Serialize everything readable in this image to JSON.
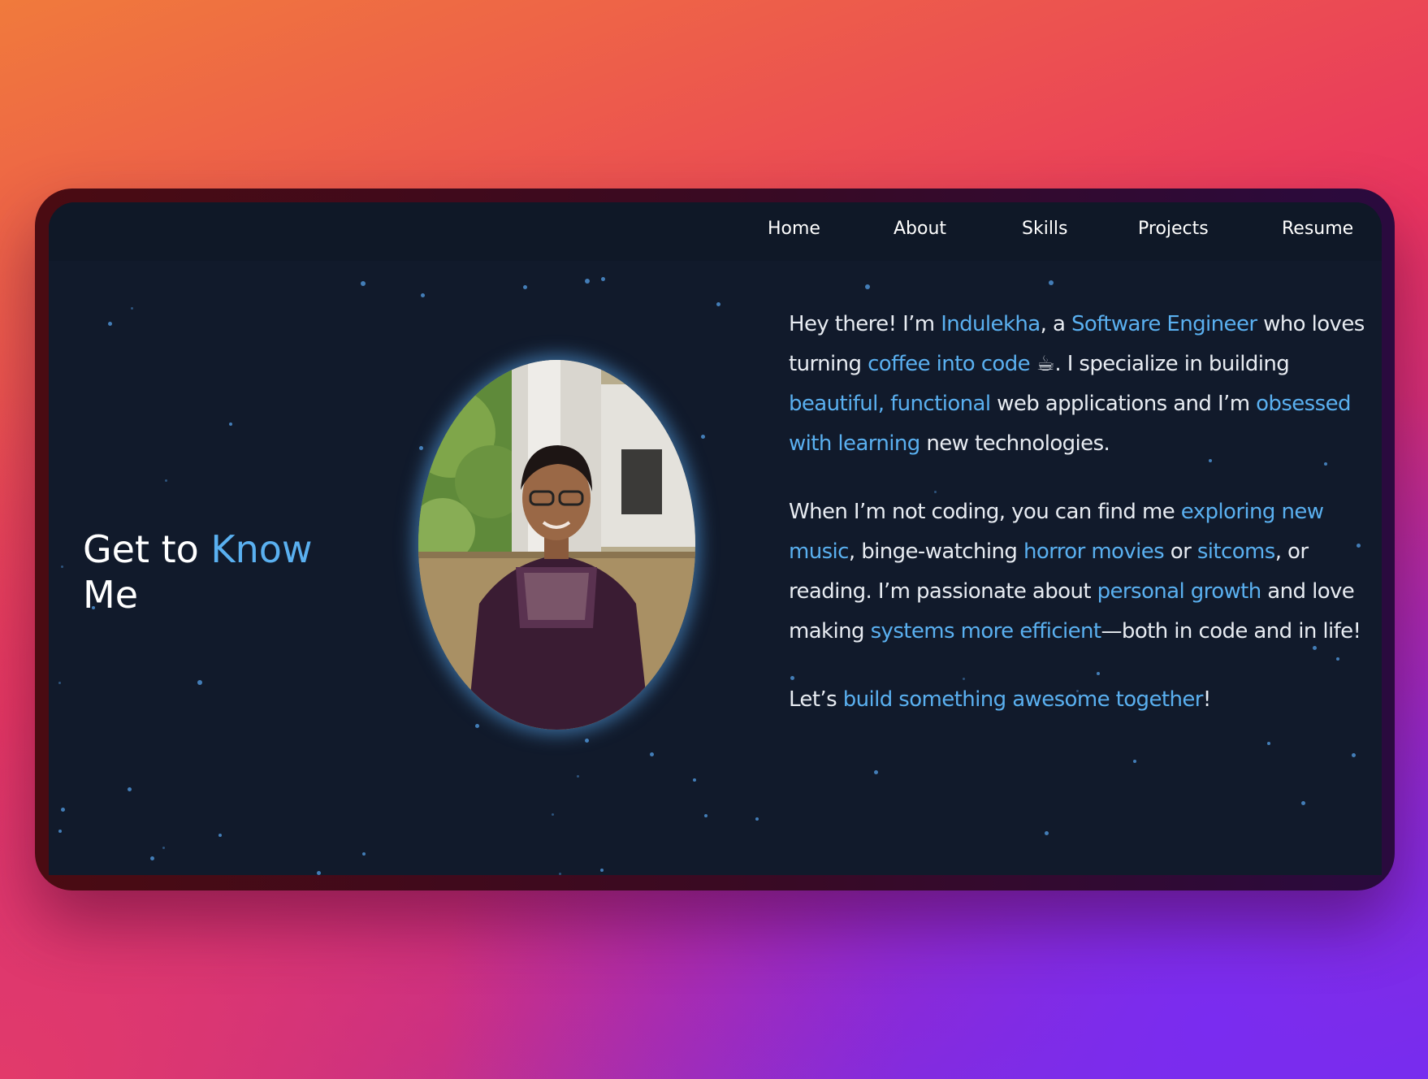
{
  "nav": {
    "items": [
      {
        "label": "Home"
      },
      {
        "label": "About"
      },
      {
        "label": "Skills"
      },
      {
        "label": "Projects"
      },
      {
        "label": "Resume"
      }
    ]
  },
  "hero": {
    "heading_part1": "Get to ",
    "heading_accent": "Know",
    "heading_part2": "Me",
    "photo_alt": "Portrait photo of Indulekha"
  },
  "bio": {
    "p1": {
      "t1": "Hey there! I’m ",
      "h1": "Indulekha",
      "t2": ", a ",
      "h2": "Software Engineer",
      "t3": " who loves turning ",
      "h3": "coffee into code",
      "emoji": " ☕",
      "t4": ". I specialize in building ",
      "h4": "beautiful, functional",
      "t5": " web applications and I’m ",
      "h5": "obsessed with learning",
      "t6": " new technologies."
    },
    "p2": {
      "t1": "When I’m not coding, you can find me ",
      "h1": "exploring new music",
      "t2": ", binge-watching ",
      "h2": "horror movies",
      "t3": " or ",
      "h3": "sitcoms",
      "t4": ", or reading. I’m passionate about ",
      "h4": "personal growth",
      "t5": " and love making ",
      "h5": "systems more efficient",
      "t6": "—both in code and in life!"
    },
    "p3": {
      "t1": "Let’s ",
      "h1": "build something awesome together",
      "t2": "!"
    }
  },
  "colors": {
    "accent": "#5ab0f0",
    "screen_bg": "#111a2b",
    "navbar_bg": "#0f1827",
    "text": "#e8ecf2"
  }
}
